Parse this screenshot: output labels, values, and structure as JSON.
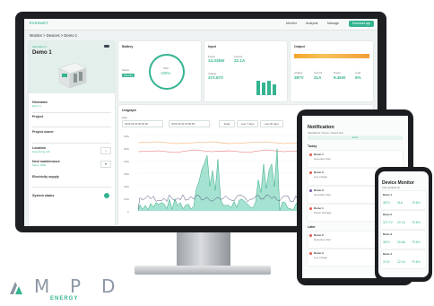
{
  "app": {
    "logo": "EVERNET",
    "nav": [
      "Monitor",
      "Analysis",
      "Manage"
    ],
    "cta": "Download app",
    "breadcrumb": "Monitor  >  Devices  >  Demo 1"
  },
  "device": {
    "tag": "Standalone 1",
    "name": "Demo 1",
    "fields": [
      {
        "label": "Nickname",
        "value": "Demo 1"
      },
      {
        "label": "Project",
        "value": ""
      },
      {
        "label": "Project owner",
        "value": ""
      },
      {
        "label": "Location",
        "value": "Hong Kong, HK"
      },
      {
        "label": "Next maintenance",
        "value": "Sep 4, 2023"
      },
      {
        "label": "Electricity supply",
        "value": ""
      },
      {
        "label": "System status",
        "value": ""
      }
    ]
  },
  "battery": {
    "title": "Battery",
    "status_label": "Status",
    "status": "Standby",
    "soc_label": "SOC",
    "soc": "100%"
  },
  "input": {
    "title": "Input",
    "power_label": "Power",
    "power": "14.33kW",
    "current_label": "Current",
    "current": "22.1A",
    "voltage_label": "Voltage",
    "voltage": "372.67V"
  },
  "output": {
    "title": "Output",
    "voltage_label": "Voltage",
    "voltage": "387V",
    "current_label": "Current",
    "current": "31A",
    "power_label": "Power",
    "power": "8.4kW",
    "load_label": "Load",
    "load": "5%"
  },
  "unigraph": {
    "title": "Unigraph",
    "date_label": "Date",
    "date_from": "2023-06-30 00:00:00",
    "date_to": "2023-06-30 23:59:59",
    "buttons": [
      "Today",
      "Last 7 days",
      "Last 30 days"
    ],
    "y_ticks": [
      "600k",
      "500k",
      "400k",
      "300k",
      "200k",
      "100k",
      "0"
    ]
  },
  "tablet": {
    "title": "Notification",
    "subtitle": "Standalone / Demo / Select item",
    "tab": "Alerts",
    "section1": "Today",
    "section2": "Later",
    "items": [
      {
        "name": "Demo 1",
        "text": "Generator Alert"
      },
      {
        "name": "Demo 2",
        "text": "Low voltage"
      },
      {
        "name": "Demo 3",
        "text": "Generator Alert"
      },
      {
        "name": "Demo 1",
        "text": "Power shortage"
      },
      {
        "name": "Demo 2",
        "text": "Generator Alert"
      },
      {
        "name": "Demo 3",
        "text": "Low voltage"
      }
    ]
  },
  "phone": {
    "title": "Device Monitor",
    "subtitle": "Last updated 2h",
    "devices": [
      {
        "name": "Demo 1",
        "v": "387V",
        "a": "31A",
        "p": "79.6%"
      },
      {
        "name": "Demo 2",
        "v": "372.7V",
        "a": "22.1A",
        "p": "79.6%"
      },
      {
        "name": "Demo 3",
        "v": "387V",
        "a": "25.8A",
        "p": "79.6%"
      },
      {
        "name": "Demo 4",
        "v": "372V",
        "a": "22.1A",
        "p": "79.6%"
      }
    ]
  },
  "brand": {
    "letters": [
      "A",
      "M",
      "P",
      "D"
    ],
    "sub": "ENERGY"
  },
  "colors": {
    "accent": "#34b491",
    "brand": "#8d97a5"
  }
}
